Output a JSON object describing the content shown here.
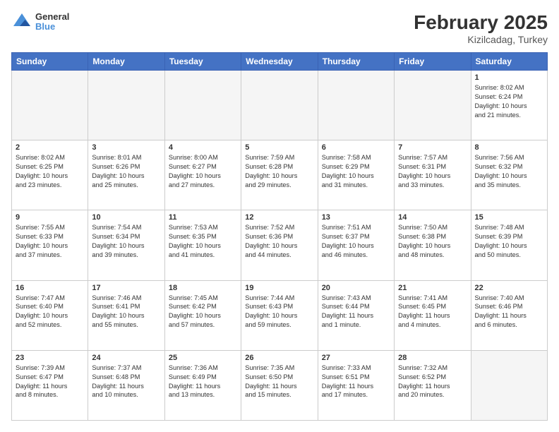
{
  "header": {
    "logo_line1": "General",
    "logo_line2": "Blue",
    "month_title": "February 2025",
    "location": "Kizilcadag, Turkey"
  },
  "days_of_week": [
    "Sunday",
    "Monday",
    "Tuesday",
    "Wednesday",
    "Thursday",
    "Friday",
    "Saturday"
  ],
  "weeks": [
    [
      {
        "day": "",
        "info": ""
      },
      {
        "day": "",
        "info": ""
      },
      {
        "day": "",
        "info": ""
      },
      {
        "day": "",
        "info": ""
      },
      {
        "day": "",
        "info": ""
      },
      {
        "day": "",
        "info": ""
      },
      {
        "day": "1",
        "info": "Sunrise: 8:02 AM\nSunset: 6:24 PM\nDaylight: 10 hours\nand 21 minutes."
      }
    ],
    [
      {
        "day": "2",
        "info": "Sunrise: 8:02 AM\nSunset: 6:25 PM\nDaylight: 10 hours\nand 23 minutes."
      },
      {
        "day": "3",
        "info": "Sunrise: 8:01 AM\nSunset: 6:26 PM\nDaylight: 10 hours\nand 25 minutes."
      },
      {
        "day": "4",
        "info": "Sunrise: 8:00 AM\nSunset: 6:27 PM\nDaylight: 10 hours\nand 27 minutes."
      },
      {
        "day": "5",
        "info": "Sunrise: 7:59 AM\nSunset: 6:28 PM\nDaylight: 10 hours\nand 29 minutes."
      },
      {
        "day": "6",
        "info": "Sunrise: 7:58 AM\nSunset: 6:29 PM\nDaylight: 10 hours\nand 31 minutes."
      },
      {
        "day": "7",
        "info": "Sunrise: 7:57 AM\nSunset: 6:31 PM\nDaylight: 10 hours\nand 33 minutes."
      },
      {
        "day": "8",
        "info": "Sunrise: 7:56 AM\nSunset: 6:32 PM\nDaylight: 10 hours\nand 35 minutes."
      }
    ],
    [
      {
        "day": "9",
        "info": "Sunrise: 7:55 AM\nSunset: 6:33 PM\nDaylight: 10 hours\nand 37 minutes."
      },
      {
        "day": "10",
        "info": "Sunrise: 7:54 AM\nSunset: 6:34 PM\nDaylight: 10 hours\nand 39 minutes."
      },
      {
        "day": "11",
        "info": "Sunrise: 7:53 AM\nSunset: 6:35 PM\nDaylight: 10 hours\nand 41 minutes."
      },
      {
        "day": "12",
        "info": "Sunrise: 7:52 AM\nSunset: 6:36 PM\nDaylight: 10 hours\nand 44 minutes."
      },
      {
        "day": "13",
        "info": "Sunrise: 7:51 AM\nSunset: 6:37 PM\nDaylight: 10 hours\nand 46 minutes."
      },
      {
        "day": "14",
        "info": "Sunrise: 7:50 AM\nSunset: 6:38 PM\nDaylight: 10 hours\nand 48 minutes."
      },
      {
        "day": "15",
        "info": "Sunrise: 7:48 AM\nSunset: 6:39 PM\nDaylight: 10 hours\nand 50 minutes."
      }
    ],
    [
      {
        "day": "16",
        "info": "Sunrise: 7:47 AM\nSunset: 6:40 PM\nDaylight: 10 hours\nand 52 minutes."
      },
      {
        "day": "17",
        "info": "Sunrise: 7:46 AM\nSunset: 6:41 PM\nDaylight: 10 hours\nand 55 minutes."
      },
      {
        "day": "18",
        "info": "Sunrise: 7:45 AM\nSunset: 6:42 PM\nDaylight: 10 hours\nand 57 minutes."
      },
      {
        "day": "19",
        "info": "Sunrise: 7:44 AM\nSunset: 6:43 PM\nDaylight: 10 hours\nand 59 minutes."
      },
      {
        "day": "20",
        "info": "Sunrise: 7:43 AM\nSunset: 6:44 PM\nDaylight: 11 hours\nand 1 minute."
      },
      {
        "day": "21",
        "info": "Sunrise: 7:41 AM\nSunset: 6:45 PM\nDaylight: 11 hours\nand 4 minutes."
      },
      {
        "day": "22",
        "info": "Sunrise: 7:40 AM\nSunset: 6:46 PM\nDaylight: 11 hours\nand 6 minutes."
      }
    ],
    [
      {
        "day": "23",
        "info": "Sunrise: 7:39 AM\nSunset: 6:47 PM\nDaylight: 11 hours\nand 8 minutes."
      },
      {
        "day": "24",
        "info": "Sunrise: 7:37 AM\nSunset: 6:48 PM\nDaylight: 11 hours\nand 10 minutes."
      },
      {
        "day": "25",
        "info": "Sunrise: 7:36 AM\nSunset: 6:49 PM\nDaylight: 11 hours\nand 13 minutes."
      },
      {
        "day": "26",
        "info": "Sunrise: 7:35 AM\nSunset: 6:50 PM\nDaylight: 11 hours\nand 15 minutes."
      },
      {
        "day": "27",
        "info": "Sunrise: 7:33 AM\nSunset: 6:51 PM\nDaylight: 11 hours\nand 17 minutes."
      },
      {
        "day": "28",
        "info": "Sunrise: 7:32 AM\nSunset: 6:52 PM\nDaylight: 11 hours\nand 20 minutes."
      },
      {
        "day": "",
        "info": ""
      }
    ]
  ]
}
